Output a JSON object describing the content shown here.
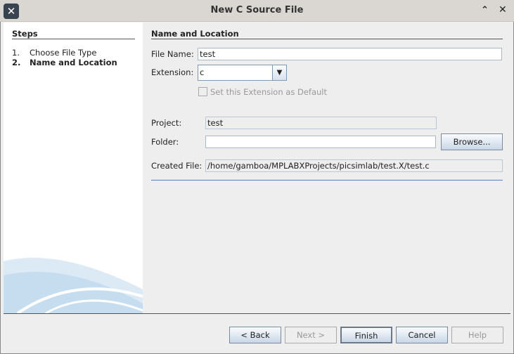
{
  "window": {
    "title": "New C Source File",
    "app_icon": "close-x-logo-icon",
    "maximize_icon": "chevron-up-icon",
    "close_icon": "close-icon"
  },
  "steps": {
    "header": "Steps",
    "items": [
      {
        "num": "1.",
        "label": "Choose File Type"
      },
      {
        "num": "2.",
        "label": "Name and Location",
        "current": true
      }
    ]
  },
  "main": {
    "header": "Name and Location",
    "file_name_label": "File Name:",
    "file_name_value": "test",
    "extension_label": "Extension:",
    "extension_value": "c",
    "default_checkbox_label": "Set this Extension as Default",
    "default_checkbox_checked": false,
    "project_label": "Project:",
    "project_value": "test",
    "folder_label": "Folder:",
    "folder_value": "",
    "browse_label": "Browse...",
    "created_file_label": "Created File:",
    "created_file_value": "/home/gamboa/MPLABXProjects/picsimlab/test.X/test.c"
  },
  "buttons": {
    "back": "< Back",
    "next": "Next >",
    "finish": "Finish",
    "cancel": "Cancel",
    "help": "Help"
  },
  "colors": {
    "accent_line": "#5b7fb8",
    "button_gradient_bottom": "#c8d6e6"
  }
}
